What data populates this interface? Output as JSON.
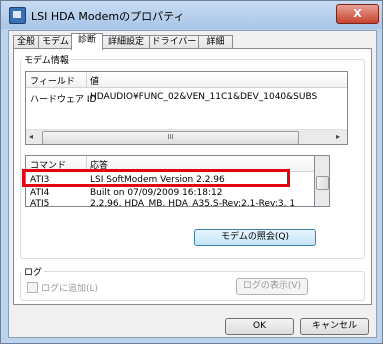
{
  "window": {
    "title": "LSI HDA Modemのプロパティ",
    "close_glyph": "X"
  },
  "tabs": [
    "全般",
    "モデム",
    "診断",
    "詳細設定",
    "ドライバー",
    "詳細"
  ],
  "active_tab": "診断",
  "modem_info": {
    "group_label": "モデム情報",
    "headers": {
      "field": "フィールド",
      "value": "値"
    },
    "rows": [
      {
        "field": "ハードウェア ID",
        "value": "HDAUDIO¥FUNC_02&VEN_11C1&DEV_1040&SUBS"
      }
    ],
    "scroll_left": "◂",
    "scroll_right": "▸",
    "scroll_grip": "III"
  },
  "command_list": {
    "headers": {
      "command": "コマンド",
      "response": "応答"
    },
    "rows": [
      {
        "command": "ATI3",
        "response": "LSI SoftModem Version 2.2.96"
      },
      {
        "command": "ATI4",
        "response": "Built on 07/09/2009 16:18:12"
      },
      {
        "command": "ATI5",
        "response": "2.2.96, HDA_MB, HDA_A35,S-Rev:2.1-Rev:3. 1"
      }
    ],
    "highlighted_command": "ATI3"
  },
  "query_modem_button": "モデムの照会(Q)",
  "log": {
    "group_label": "ログ",
    "append_checkbox_label": "ログに追加(L)",
    "append_checked": false,
    "view_log_button": "ログの表示(V)"
  },
  "footer": {
    "ok_button": "OK",
    "cancel_button": "キャンセル"
  },
  "colors": {
    "highlight": "#e60012",
    "title_bar": "#bcd3ee"
  }
}
